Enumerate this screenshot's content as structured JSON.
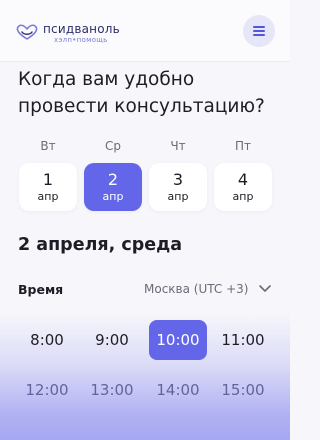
{
  "brand": {
    "name": "псидваноль",
    "tagline": "хэлп•помощь",
    "color_primary": "#2b2f6b",
    "color_accent": "#6466ea"
  },
  "header": {
    "menu_icon": "hamburger-menu-icon"
  },
  "question": "Когда вам удобно провести консультацию?",
  "days": [
    {
      "dow": "Вт",
      "num": "1",
      "month": "апр",
      "selected": false
    },
    {
      "dow": "Ср",
      "num": "2",
      "month": "апр",
      "selected": true
    },
    {
      "dow": "Чт",
      "num": "3",
      "month": "апр",
      "selected": false
    },
    {
      "dow": "Пт",
      "num": "4",
      "month": "апр",
      "selected": false
    }
  ],
  "date_heading": "2 апреля, среда",
  "time": {
    "label": "Время",
    "timezone": "Москва (UTC +3)",
    "slots": [
      {
        "label": "8:00",
        "selected": false
      },
      {
        "label": "9:00",
        "selected": false
      },
      {
        "label": "10:00",
        "selected": true
      },
      {
        "label": "11:00",
        "selected": false
      },
      {
        "label": "12:00",
        "selected": false
      },
      {
        "label": "13:00",
        "selected": false
      },
      {
        "label": "14:00",
        "selected": false
      },
      {
        "label": "15:00",
        "selected": false
      }
    ]
  }
}
